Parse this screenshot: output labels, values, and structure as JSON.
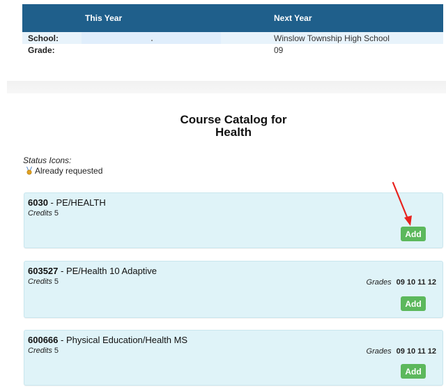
{
  "info": {
    "this_year_label": "This Year",
    "next_year_label": "Next Year",
    "school_label": "School:",
    "school_next": "Winslow Township High School",
    "grade_label": "Grade:",
    "grade_next": "09"
  },
  "catalog": {
    "title_line1": "Course Catalog for",
    "title_line2": "Health"
  },
  "status": {
    "title": "Status Icons:",
    "already_requested": "Already requested"
  },
  "courses": [
    {
      "code": "6030",
      "name": " - PE/HEALTH",
      "credits_label": "Credits",
      "credits": "5",
      "grades_label": "",
      "grades": [],
      "add_label": "Add"
    },
    {
      "code": "603527",
      "name": " - PE/Health 10 Adaptive",
      "credits_label": "Credits",
      "credits": "5",
      "grades_label": "Grades",
      "grades": [
        "09",
        "10",
        "11",
        "12"
      ],
      "add_label": "Add"
    },
    {
      "code": "600666",
      "name": " - Physical Education/Health MS",
      "credits_label": "Credits",
      "credits": "5",
      "grades_label": "Grades",
      "grades": [
        "09",
        "10",
        "11",
        "12"
      ],
      "add_label": "Add"
    }
  ],
  "colors": {
    "header_bg": "#1f5f8b",
    "card_bg": "#dff3f8",
    "add_button": "#5cb85c",
    "arrow": "#e8221e"
  }
}
